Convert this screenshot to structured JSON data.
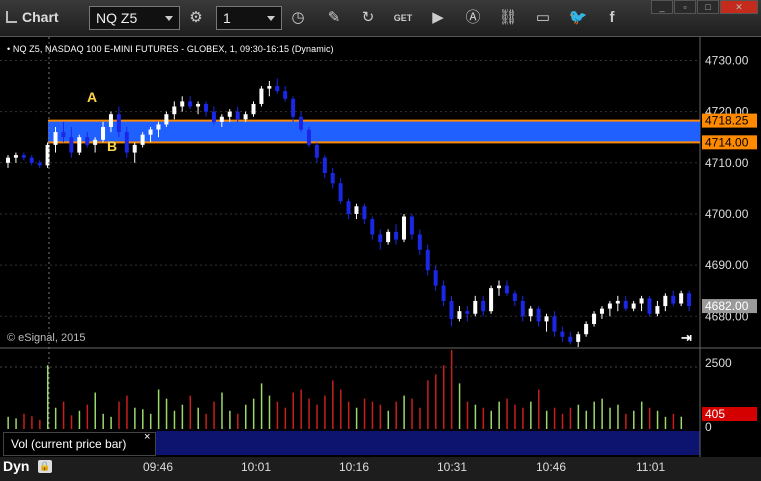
{
  "window": {
    "title": "Chart"
  },
  "toolbar": {
    "symbol": "NQ Z5",
    "interval": "1",
    "buttons": [
      "settings-gear",
      "clock",
      "pencil",
      "refresh",
      "get-quote",
      "play",
      "alerts",
      "link",
      "chat",
      "twitter",
      "facebook"
    ]
  },
  "chart": {
    "header": "• NQ Z5, NASDAQ 100 E-MINI FUTURES - GLOBEX, 1, 09:30-16:15 (Dynamic)",
    "watermark": "© eSignal, 2015",
    "annotations": {
      "a": "A",
      "b": "B"
    },
    "price_axis": [
      "4730.00",
      "4720.00",
      "4710.00",
      "4700.00",
      "4690.00",
      "4680.00"
    ],
    "level_labels": {
      "upper": "4718.25",
      "lower": "4714.00",
      "last": "4682.00"
    },
    "volume_axis": {
      "top": "2500",
      "zero": "0",
      "last": "405"
    },
    "volume_label": "Vol (current price bar)",
    "volume_close": "×",
    "time_axis": [
      "09:46",
      "10:01",
      "10:16",
      "10:31",
      "10:46",
      "11:01"
    ],
    "dyn_label": "Dyn",
    "colors": {
      "up": "#ffffff",
      "down": "#1a28e6",
      "zone": "#2060ff",
      "zone_edge": "#ff8a00",
      "vol_up": "#9bd96c",
      "vol_down": "#c81e1e",
      "axis_bg": "#000"
    }
  },
  "chart_data": {
    "type": "candlestick",
    "x_start": "09:30",
    "interval_minutes": 1,
    "ylim": [
      4674,
      4734
    ],
    "zone": [
      4714.0,
      4718.25
    ],
    "series": [
      {
        "name": "NQ Z5",
        "values": [
          [
            4710,
            4711.5,
            4709,
            4711
          ],
          [
            4711,
            4712,
            4710,
            4711.5
          ],
          [
            4711.5,
            4712,
            4710.5,
            4711
          ],
          [
            4711,
            4711.5,
            4709.5,
            4710
          ],
          [
            4710,
            4710.5,
            4709,
            4709.5
          ],
          [
            4709.5,
            4714,
            4709,
            4713.5
          ],
          [
            4713.5,
            4717,
            4712,
            4716
          ],
          [
            4716,
            4718,
            4714,
            4715
          ],
          [
            4715,
            4717,
            4711,
            4712
          ],
          [
            4712,
            4715.5,
            4711.5,
            4715
          ],
          [
            4715,
            4716,
            4713,
            4713.5
          ],
          [
            4713.5,
            4715,
            4712,
            4714.5
          ],
          [
            4714.5,
            4718,
            4714,
            4717
          ],
          [
            4717,
            4720,
            4716,
            4719.5
          ],
          [
            4719.5,
            4721,
            4715,
            4716
          ],
          [
            4716,
            4717,
            4711,
            4712
          ],
          [
            4712,
            4714,
            4710,
            4713.5
          ],
          [
            4713.5,
            4716,
            4713,
            4715.5
          ],
          [
            4715.5,
            4717,
            4714,
            4716.5
          ],
          [
            4716.5,
            4718,
            4715,
            4717.5
          ],
          [
            4717.5,
            4720,
            4717,
            4719.5
          ],
          [
            4719.5,
            4722,
            4718.5,
            4721
          ],
          [
            4721,
            4723,
            4720,
            4722
          ],
          [
            4722,
            4723,
            4720.5,
            4721
          ],
          [
            4721,
            4722,
            4719.5,
            4721.5
          ],
          [
            4721.5,
            4722,
            4719,
            4720
          ],
          [
            4720,
            4721,
            4717.5,
            4718
          ],
          [
            4718,
            4719.5,
            4717,
            4719
          ],
          [
            4719,
            4720.5,
            4718,
            4720
          ],
          [
            4720,
            4721,
            4718,
            4718.5
          ],
          [
            4718.5,
            4720,
            4718,
            4719.5
          ],
          [
            4719.5,
            4722,
            4719,
            4721.5
          ],
          [
            4721.5,
            4725,
            4721,
            4724.5
          ],
          [
            4724.5,
            4726,
            4723,
            4725
          ],
          [
            4725,
            4726.5,
            4723.5,
            4724
          ],
          [
            4724,
            4725,
            4722,
            4722.5
          ],
          [
            4722.5,
            4723,
            4718,
            4719
          ],
          [
            4719,
            4720,
            4716,
            4716.5
          ],
          [
            4716.5,
            4717,
            4713,
            4713.5
          ],
          [
            4713.5,
            4714,
            4710,
            4711
          ],
          [
            4711,
            4711.5,
            4707,
            4708
          ],
          [
            4708,
            4709,
            4705,
            4706
          ],
          [
            4706,
            4707,
            4702,
            4702.5
          ],
          [
            4702.5,
            4703,
            4699,
            4700
          ],
          [
            4700,
            4702,
            4699,
            4701.5
          ],
          [
            4701.5,
            4702,
            4698,
            4699
          ],
          [
            4699,
            4699.5,
            4695,
            4696
          ],
          [
            4696,
            4697,
            4693,
            4694.5
          ],
          [
            4694.5,
            4697,
            4694,
            4696.5
          ],
          [
            4696.5,
            4698,
            4694,
            4695
          ],
          [
            4695,
            4700,
            4694.5,
            4699.5
          ],
          [
            4699.5,
            4700,
            4695,
            4696
          ],
          [
            4696,
            4697,
            4692,
            4693
          ],
          [
            4693,
            4694,
            4688,
            4689
          ],
          [
            4689,
            4690,
            4685,
            4686
          ],
          [
            4686,
            4687,
            4682,
            4683
          ],
          [
            4683,
            4684,
            4678,
            4679.5
          ],
          [
            4679.5,
            4682,
            4679,
            4681
          ],
          [
            4681,
            4682,
            4679,
            4680.5
          ],
          [
            4680.5,
            4684,
            4680,
            4683
          ],
          [
            4683,
            4684,
            4680,
            4681
          ],
          [
            4681,
            4686,
            4680.5,
            4685.5
          ],
          [
            4685.5,
            4687,
            4684,
            4686
          ],
          [
            4686,
            4687,
            4684,
            4684.5
          ],
          [
            4684.5,
            4685,
            4682,
            4683
          ],
          [
            4683,
            4684,
            4679,
            4680
          ],
          [
            4680,
            4682,
            4679,
            4681.5
          ],
          [
            4681.5,
            4682,
            4678,
            4679
          ],
          [
            4679,
            4680.5,
            4677,
            4680
          ],
          [
            4680,
            4681,
            4676,
            4677
          ],
          [
            4677,
            4678,
            4675,
            4676
          ],
          [
            4676,
            4677,
            4674.5,
            4675
          ],
          [
            4675,
            4677,
            4674,
            4676.5
          ],
          [
            4676.5,
            4679,
            4676,
            4678.5
          ],
          [
            4678.5,
            4681,
            4678,
            4680.5
          ],
          [
            4680.5,
            4682,
            4679.5,
            4681.5
          ],
          [
            4681.5,
            4683,
            4680,
            4682.5
          ],
          [
            4682.5,
            4684,
            4681,
            4683
          ],
          [
            4683,
            4684,
            4681,
            4681.5
          ],
          [
            4681.5,
            4683,
            4681,
            4682.5
          ],
          [
            4682.5,
            4684,
            4681,
            4683.5
          ],
          [
            4683.5,
            4684,
            4680,
            4680.5
          ],
          [
            4680.5,
            4683,
            4680,
            4682
          ],
          [
            4682,
            4684.5,
            4681,
            4684
          ],
          [
            4684,
            4685,
            4682,
            4682.5
          ],
          [
            4682.5,
            4685,
            4682,
            4684.5
          ],
          [
            4684.5,
            4685,
            4681,
            4682
          ]
        ]
      },
      {
        "name": "Vol",
        "values": [
          400,
          350,
          500,
          420,
          300,
          2100,
          700,
          900,
          450,
          600,
          800,
          1200,
          500,
          400,
          900,
          1100,
          700,
          650,
          500,
          1300,
          1000,
          600,
          800,
          1100,
          700,
          500,
          900,
          1200,
          600,
          500,
          800,
          1000,
          1500,
          1100,
          900,
          700,
          1200,
          1300,
          1000,
          800,
          1100,
          1600,
          1300,
          900,
          700,
          1000,
          900,
          800,
          600,
          900,
          1100,
          1000,
          700,
          1600,
          1800,
          2100,
          2600,
          1500,
          900,
          800,
          700,
          600,
          900,
          1000,
          800,
          700,
          900,
          1300,
          600,
          700,
          500,
          700,
          800,
          600,
          900,
          1000,
          700,
          800,
          500,
          600,
          900,
          700,
          600,
          400,
          500,
          405
        ]
      }
    ]
  }
}
